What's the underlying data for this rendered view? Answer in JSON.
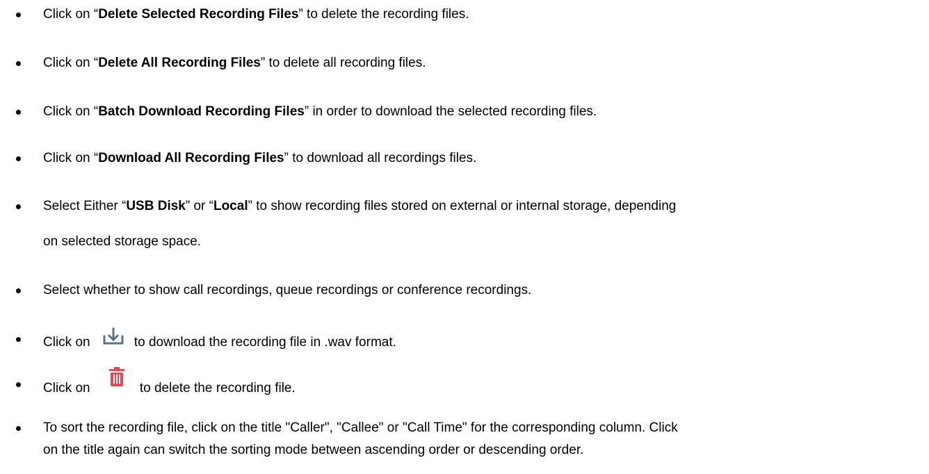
{
  "items": [
    {
      "pre": "Click on “",
      "bold": "Delete Selected Recording Files",
      "post": "” to delete the recording files."
    },
    {
      "pre": "Click on “",
      "bold": "Delete All Recording Files",
      "post": "” to delete all recording files."
    },
    {
      "pre": "Click on “",
      "bold": "Batch Download Recording Files",
      "post": "” in order to download the selected recording files."
    },
    {
      "pre": "Click on “",
      "bold": "Download All Recording Files",
      "post": "” to download all recordings files."
    },
    {
      "pre": "Select Either “",
      "bold1": "USB Disk",
      "mid": "” or “",
      "bold2": "Local",
      "post": "” to show recording files stored on external or internal storage, depending",
      "line2": "on selected storage space."
    },
    {
      "text": "Select whether to show call recordings, queue recordings or conference recordings."
    },
    {
      "pre": "Click on",
      "icon": "download-icon",
      "post": "to download the recording file in .wav format."
    },
    {
      "pre": "Click on",
      "icon": "trash-icon",
      "post": "to delete the recording file."
    },
    {
      "line1": "To sort the recording file, click on the title \"Caller\", \"Callee\" or \"Call Time\" for the corresponding column. Click",
      "line2": "on the title again can switch the sorting mode between ascending order or descending order."
    }
  ],
  "colors": {
    "download_icon": "#5a7288",
    "trash_icon": "#e8475a"
  }
}
